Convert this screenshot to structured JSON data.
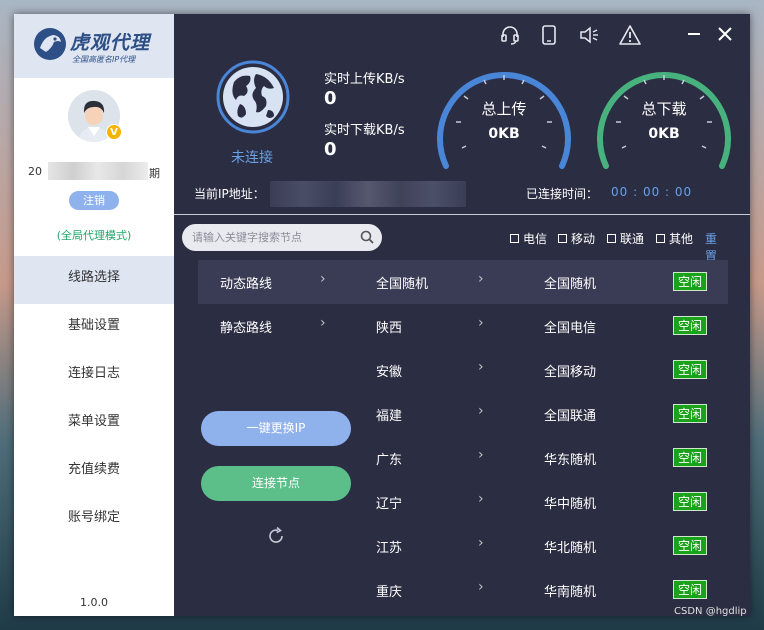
{
  "app": {
    "logo_text": "虎观代理",
    "logo_sub": "全国高匿名IP代理",
    "version": "1.0.0"
  },
  "user": {
    "name_prefix": "20",
    "name_suffix": "期",
    "vip_badge": "V",
    "logout_label": "注销",
    "mode_label": "(全局代理模式)"
  },
  "sidebar": {
    "items": [
      {
        "label": "线路选择",
        "active": true
      },
      {
        "label": "基础设置",
        "active": false
      },
      {
        "label": "连接日志",
        "active": false
      },
      {
        "label": "菜单设置",
        "active": false
      },
      {
        "label": "充值续费",
        "active": false
      },
      {
        "label": "账号绑定",
        "active": false
      }
    ]
  },
  "status": {
    "connection": "未连接",
    "upload_label": "实时上传KB/s",
    "upload_value": "0",
    "download_label": "实时下载KB/s",
    "download_value": "0",
    "total_upload_title": "总上传",
    "total_upload_value": "0KB",
    "total_download_title": "总下载",
    "total_download_value": "0KB",
    "ip_label": "当前IP地址：",
    "connected_time_label": "已连接时间：",
    "connected_time_value": "00 : 00 : 00"
  },
  "search": {
    "placeholder": "请输入关键字搜索节点"
  },
  "filters": {
    "options": [
      "电信",
      "移动",
      "联通",
      "其他"
    ],
    "reset_label": "重置"
  },
  "route_types": [
    "动态路线",
    "静态路线"
  ],
  "provinces": [
    "全国随机",
    "陕西",
    "安徽",
    "福建",
    "广东",
    "辽宁",
    "江苏",
    "重庆"
  ],
  "nodes": [
    {
      "name": "全国随机",
      "status": "空闲"
    },
    {
      "name": "全国电信",
      "status": "空闲"
    },
    {
      "name": "全国移动",
      "status": "空闲"
    },
    {
      "name": "全国联通",
      "status": "空闲"
    },
    {
      "name": "华东随机",
      "status": "空闲"
    },
    {
      "name": "华中随机",
      "status": "空闲"
    },
    {
      "name": "华北随机",
      "status": "空闲"
    },
    {
      "name": "华南随机",
      "status": "空闲"
    }
  ],
  "actions": {
    "change_ip_label": "一键更换IP",
    "connect_label": "连接节点"
  },
  "watermark": "CSDN @hgdlip",
  "colors": {
    "accent_blue": "#6aa0e6",
    "upload_gauge": "#4a86d8",
    "download_gauge": "#48b27e",
    "idle_green": "#1aa31a",
    "panel_bg": "#2b2d42"
  }
}
